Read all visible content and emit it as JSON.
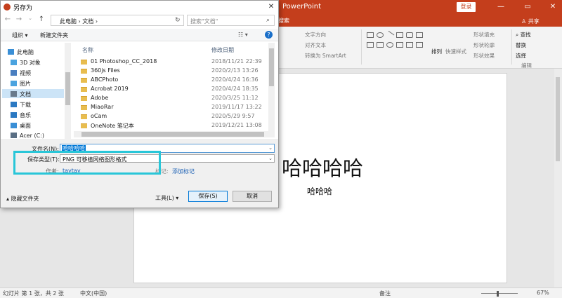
{
  "ppt": {
    "title": "PowerPoint",
    "login": "登录",
    "share": "共享",
    "win_controls": [
      "—",
      "▭",
      "✕"
    ],
    "search_tab": "搜索"
  },
  "ribbon": {
    "text_direction": "文字方向",
    "align_text": "对齐文本",
    "to_smartart": "转换为 SmartArt",
    "arrange": "排列",
    "quick_styles": "快速样式",
    "shape_fill": "形状填充",
    "shape_outline": "形状轮廓",
    "shape_effects": "形状效果",
    "find": "查找",
    "replace": "替换",
    "select": "选择",
    "editing_group": "编辑"
  },
  "slide": {
    "title": "哈哈哈哈",
    "subtitle": "哈哈哈"
  },
  "status": {
    "slide_info": "幻灯片 第 1 张，共 2 张",
    "language": "中文(中国)",
    "notes": "备注",
    "zoom": "67%"
  },
  "dialog": {
    "title": "另存为",
    "breadcrumb": "此电脑  ›  文档  ›",
    "search_placeholder": "搜索\"文档\"",
    "organize": "组织 ▾",
    "new_folder": "新建文件夹",
    "nav_items": [
      {
        "label": "此电脑",
        "color": "#3a8fd6"
      },
      {
        "label": "3D 对象",
        "color": "#4aa3df"
      },
      {
        "label": "视频",
        "color": "#4a7fc0"
      },
      {
        "label": "图片",
        "color": "#4aa3df"
      },
      {
        "label": "文档",
        "color": "#6b7b8c"
      },
      {
        "label": "下载",
        "color": "#2b79c2"
      },
      {
        "label": "音乐",
        "color": "#2b79c2"
      },
      {
        "label": "桌面",
        "color": "#3a8fd6"
      },
      {
        "label": "Acer (C:)",
        "color": "#5a6f84"
      }
    ],
    "columns": {
      "name": "名称",
      "date": "修改日期"
    },
    "files": [
      {
        "name": "01 Photoshop_CC_2018",
        "date": "2018/11/21 22:39"
      },
      {
        "name": "360js Files",
        "date": "2020/2/13 13:26"
      },
      {
        "name": "ABCPhoto",
        "date": "2020/4/24 16:36"
      },
      {
        "name": "Acrobat 2019",
        "date": "2020/4/24 18:35"
      },
      {
        "name": "Adobe",
        "date": "2020/3/25 11:12"
      },
      {
        "name": "MiaoRar",
        "date": "2019/11/17 13:22"
      },
      {
        "name": "oCam",
        "date": "2020/5/29 9:57"
      },
      {
        "name": "OneNote 笔记本",
        "date": "2019/12/21 13:08"
      }
    ],
    "filename_label": "文件名(N):",
    "filename_value": "哈哈哈哈",
    "filetype_label": "保存类型(T):",
    "filetype_value": "PNG 可移植网络图形格式",
    "author_label": "作者:",
    "author_value": "taytay",
    "tags_label": "标记:",
    "tags_value": "添加标记",
    "hide_folders": "隐藏文件夹",
    "tools": "工具(L)",
    "save": "保存(S)",
    "cancel": "取消"
  }
}
